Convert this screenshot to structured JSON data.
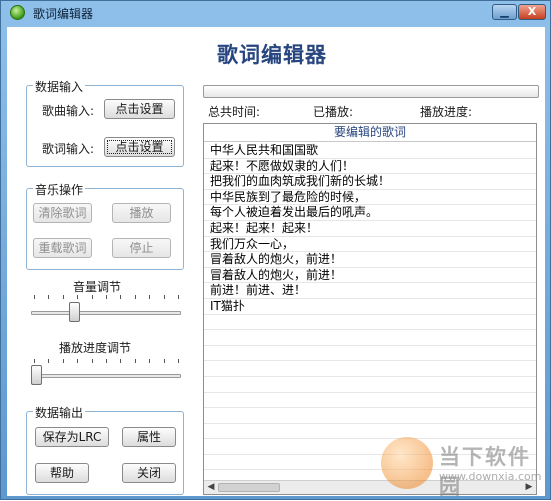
{
  "window": {
    "title": "歌词编辑器",
    "minimize_glyph": "▁",
    "close_glyph": "X"
  },
  "app_title": "歌词编辑器",
  "data_input": {
    "legend": "数据输入",
    "song_label": "歌曲输入:",
    "song_button": "点击设置",
    "lyric_label": "歌词输入:",
    "lyric_button": "点击设置"
  },
  "music_ops": {
    "legend": "音乐操作",
    "clear_button": "清除歌词",
    "play_button": "播放",
    "reload_button": "重载歌词",
    "stop_button": "停止"
  },
  "volume": {
    "label": "音量调节",
    "level": 0.27
  },
  "playback_seek": {
    "label": "播放进度调节",
    "level": 0.0
  },
  "data_output": {
    "legend": "数据输出",
    "save_lrc_button": "保存为LRC",
    "properties_button": "属性",
    "help_button": "帮助",
    "close_button": "关闭"
  },
  "progress": {
    "fill": 0.0
  },
  "status": {
    "total_time_label": "总共时间:",
    "played_label": "已播放:",
    "progress_label": "播放进度:"
  },
  "lyrics_panel": {
    "header": "要编辑的歌词",
    "lines": [
      "中华人民共和国国歌",
      "起来！不愿做奴隶的人们！",
      "把我们的血肉筑成我们新的长城！",
      "中华民族到了最危险的时候，",
      "每个人被迫着发出最后的吼声。",
      "起来！起来！起来！",
      "我们万众一心，",
      "冒着敌人的炮火，前进！",
      "冒着敌人的炮火，前进！",
      "前进！前进、进！",
      "IT猫扑",
      "",
      "",
      "",
      "",
      "",
      "",
      "",
      "",
      "",
      ""
    ]
  },
  "watermark": {
    "name": "当下软件园",
    "url": "www.downxia.com"
  }
}
